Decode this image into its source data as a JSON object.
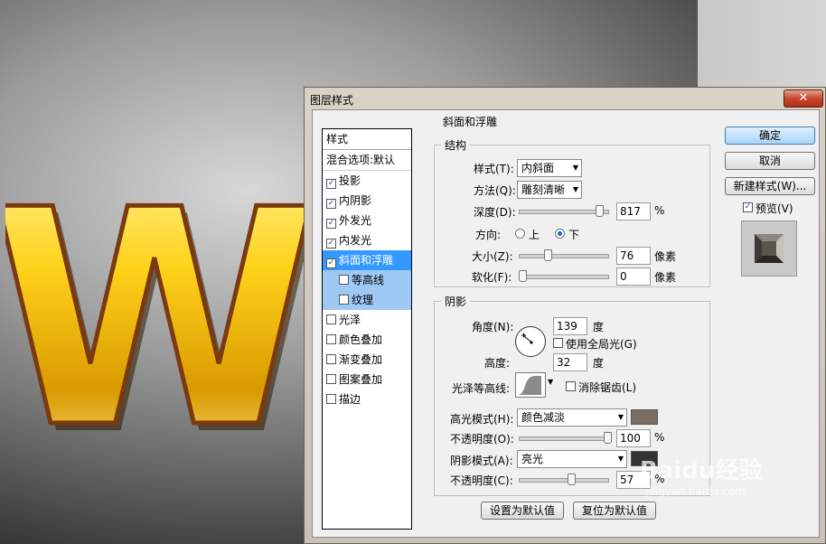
{
  "dialog": {
    "title": "图层样式",
    "close": "✕"
  },
  "styles": {
    "header": "样式",
    "blend": "混合选项:默认",
    "items": [
      {
        "label": "投影",
        "checked": true
      },
      {
        "label": "内阴影",
        "checked": true
      },
      {
        "label": "外发光",
        "checked": true
      },
      {
        "label": "内发光",
        "checked": true
      },
      {
        "label": "斜面和浮雕",
        "checked": true
      },
      {
        "label": "等高线",
        "checked": false
      },
      {
        "label": "纹理",
        "checked": false
      },
      {
        "label": "光泽",
        "checked": false
      },
      {
        "label": "颜色叠加",
        "checked": false
      },
      {
        "label": "渐变叠加",
        "checked": false
      },
      {
        "label": "图案叠加",
        "checked": false
      },
      {
        "label": "描边",
        "checked": false
      }
    ]
  },
  "bevel": {
    "title": "斜面和浮雕",
    "structure": {
      "title": "结构",
      "style_label": "样式(T):",
      "style_value": "内斜面",
      "technique_label": "方法(Q):",
      "technique_value": "雕刻清晰",
      "depth_label": "深度(D):",
      "depth_value": "817",
      "depth_unit": "%",
      "depth_level": 0.9,
      "direction_label": "方向:",
      "dir_up": "上",
      "dir_down": "下",
      "size_label": "大小(Z):",
      "size_value": "76",
      "size_unit": "像素",
      "size_level": 0.3,
      "soften_label": "软化(F):",
      "soften_value": "0",
      "soften_unit": "像素",
      "soften_level": 0.0
    },
    "shading": {
      "title": "阴影",
      "angle_label": "角度(N):",
      "angle_value": "139",
      "angle_unit": "度",
      "global_light": "使用全局光(G)",
      "altitude_label": "高度:",
      "altitude_value": "32",
      "altitude_unit": "度",
      "gloss_label": "光泽等高线:",
      "antialias": "消除锯齿(L)",
      "highlight_mode_label": "高光模式(H):",
      "highlight_mode": "颜色减淡",
      "highlight_color": "#7a6e62",
      "opacity_label": "不透明度(O):",
      "highlight_opacity": "100",
      "highlight_opacity_level": 1.0,
      "shadow_mode_label": "阴影模式(A):",
      "shadow_mode": "亮光",
      "shadow_color": "#333333",
      "opacity2_label": "不透明度(C):",
      "shadow_opacity": "57",
      "shadow_opacity_level": 0.57,
      "percent": "%"
    },
    "make_default": "设置为默认值",
    "reset_default": "复位为默认值"
  },
  "buttons": {
    "ok": "确定",
    "cancel": "取消",
    "new_style": "新建样式(W)...",
    "preview": "预览(V)"
  },
  "watermark": {
    "brand": "Baidu经验",
    "url": "jingyan.baidu.com"
  },
  "artwork": {
    "letter": "W"
  }
}
